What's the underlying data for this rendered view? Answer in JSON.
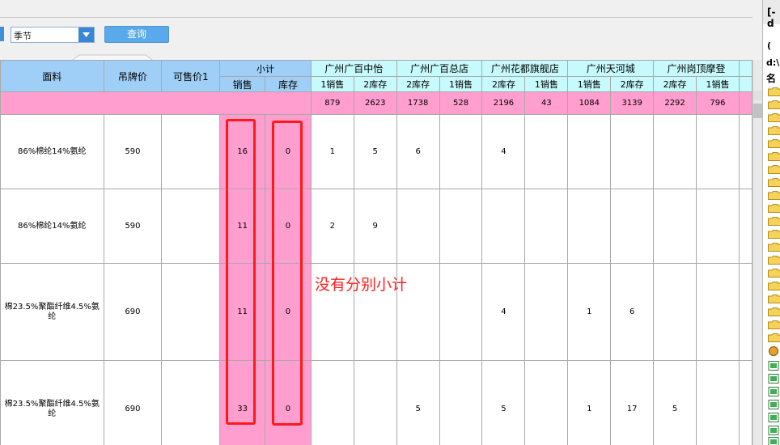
{
  "toolbar": {
    "season_value": "季节",
    "query_label": "查询"
  },
  "header": {
    "fabric": "面料",
    "tag_price": "吊牌价",
    "sale_price": "可售价1",
    "subtotal": "小计",
    "sales": "销售",
    "stock": "库存",
    "stores": [
      "广州广百中怡",
      "广州广百总店",
      "广州花都旗舰店",
      "广州天河城",
      "广州岗顶摩登"
    ],
    "store_subcols": [
      "1销售",
      "2库存",
      "2库存",
      "1销售",
      "2库存",
      "1销售",
      "1销售",
      "2库存",
      "2库存",
      "1销售"
    ]
  },
  "summary": [
    "879",
    "2623",
    "1738",
    "528",
    "2196",
    "43",
    "1084",
    "3139",
    "2292",
    "796"
  ],
  "rows": [
    {
      "fabric": "86%棉纶14%氨纶",
      "tag_price": "590",
      "sale_price": "",
      "sales": "16",
      "stock": "0",
      "cells": [
        "1",
        "5",
        "6",
        "",
        "4",
        "",
        "",
        "",
        "",
        ""
      ]
    },
    {
      "fabric": "86%棉纶14%氨纶",
      "tag_price": "590",
      "sale_price": "",
      "sales": "11",
      "stock": "0",
      "cells": [
        "2",
        "9",
        "",
        "",
        "",
        "",
        "",
        "",
        "",
        ""
      ]
    },
    {
      "fabric": "棉23.5%聚酯纤维4.5%氨纶",
      "tag_price": "690",
      "sale_price": "",
      "sales": "11",
      "stock": "0",
      "cells": [
        "",
        "",
        "",
        "",
        "4",
        "",
        "1",
        "6",
        "",
        ""
      ]
    },
    {
      "fabric": "棉23.5%聚酯纤维4.5%氨纶",
      "tag_price": "690",
      "sale_price": "",
      "sales": "33",
      "stock": "0",
      "cells": [
        "",
        "",
        "5",
        "",
        "5",
        "",
        "1",
        "17",
        "5",
        ""
      ]
    }
  ],
  "annotation": "没有分别小计",
  "right_panel": {
    "title": "[-d",
    "tab": "(",
    "path": "d:\\",
    "col": "名"
  }
}
